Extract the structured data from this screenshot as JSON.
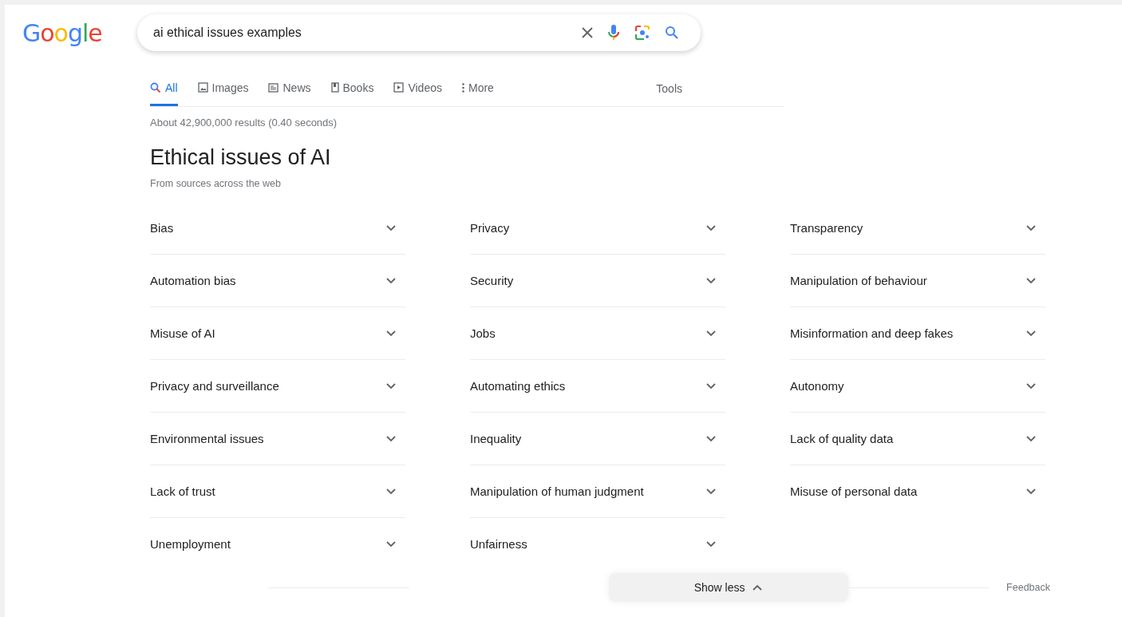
{
  "logo": "Google",
  "search": {
    "value": "ai ethical issues examples"
  },
  "tabs": [
    {
      "label": "All",
      "kind": "search",
      "selected": true
    },
    {
      "label": "Images",
      "kind": "image",
      "selected": false
    },
    {
      "label": "News",
      "kind": "news",
      "selected": false
    },
    {
      "label": "Books",
      "kind": "book",
      "selected": false
    },
    {
      "label": "Videos",
      "kind": "video",
      "selected": false
    },
    {
      "label": "More",
      "kind": "dots",
      "selected": false
    }
  ],
  "tools": "Tools",
  "result_stats": "About 42,900,000 results (0.40 seconds)",
  "panel": {
    "title": "Ethical issues of AI",
    "subtitle": "From sources across the web",
    "columns": [
      [
        {
          "label": "Bias",
          "expanded": false
        },
        {
          "label": "Automation bias",
          "expanded": false
        },
        {
          "label": "Misuse of AI",
          "expanded": false
        },
        {
          "label": "Privacy and surveillance",
          "expanded": false
        },
        {
          "label": "Environmental issues",
          "expanded": false
        },
        {
          "label": "Lack of trust",
          "expanded": false
        },
        {
          "label": "Unemployment",
          "expanded": false
        }
      ],
      [
        {
          "label": "Privacy",
          "expanded": false
        },
        {
          "label": "Security",
          "expanded": false
        },
        {
          "label": "Jobs",
          "expanded": false
        },
        {
          "label": "Automating ethics",
          "expanded": false
        },
        {
          "label": "Inequality",
          "expanded": false
        },
        {
          "label": "Manipulation of human judgment",
          "expanded": false
        },
        {
          "label": "Unfairness",
          "expanded": false
        }
      ],
      [
        {
          "label": "Transparency",
          "expanded": false
        },
        {
          "label": "Manipulation of behaviour",
          "expanded": false
        },
        {
          "label": "Misinformation and deep fakes",
          "expanded": false
        },
        {
          "label": "Autonomy",
          "expanded": false
        },
        {
          "label": "Lack of quality data",
          "expanded": false
        },
        {
          "label": "Misuse of personal data",
          "expanded": false
        }
      ]
    ],
    "show_less": "Show less",
    "feedback": "Feedback"
  }
}
